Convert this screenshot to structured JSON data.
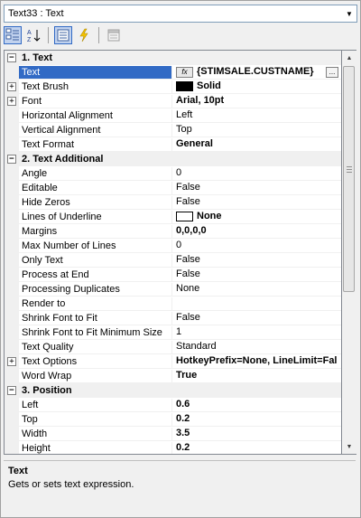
{
  "object_selector": {
    "value": "Text33 : Text"
  },
  "categories": [
    {
      "label": "1. Text",
      "rows": [
        {
          "name": "Text",
          "value": "{STIMSALE.CUSTNAME}",
          "bold": true,
          "selected": true,
          "expr": true,
          "expand": false
        },
        {
          "name": "Text Brush",
          "value": "Solid",
          "bold": true,
          "swatch": "#000000",
          "expand": true
        },
        {
          "name": "Font",
          "value": "Arial, 10pt",
          "bold": true,
          "expand": true
        },
        {
          "name": "Horizontal Alignment",
          "value": "Left"
        },
        {
          "name": "Vertical Alignment",
          "value": "Top"
        },
        {
          "name": "Text Format",
          "value": "General",
          "bold": true
        }
      ]
    },
    {
      "label": "2. Text  Additional",
      "rows": [
        {
          "name": "Angle",
          "value": "0"
        },
        {
          "name": "Editable",
          "value": "False"
        },
        {
          "name": "Hide Zeros",
          "value": "False"
        },
        {
          "name": "Lines of Underline",
          "value": "None",
          "bold": true,
          "swatch": "#ffffff"
        },
        {
          "name": "Margins",
          "value": "0,0,0,0",
          "bold": true
        },
        {
          "name": "Max Number of Lines",
          "value": "0"
        },
        {
          "name": "Only Text",
          "value": "False"
        },
        {
          "name": "Process at End",
          "value": "False"
        },
        {
          "name": "Processing Duplicates",
          "value": "None"
        },
        {
          "name": "Render to",
          "value": ""
        },
        {
          "name": "Shrink Font to Fit",
          "value": "False"
        },
        {
          "name": "Shrink Font to Fit Minimum Size",
          "value": "1"
        },
        {
          "name": "Text Quality",
          "value": "Standard"
        },
        {
          "name": "Text Options",
          "value": "HotkeyPrefix=None, LineLimit=Fal",
          "bold": true,
          "expand": true
        },
        {
          "name": "Word Wrap",
          "value": "True",
          "bold": true
        }
      ]
    },
    {
      "label": "3. Position",
      "rows": [
        {
          "name": "Left",
          "value": "0.6",
          "bold": true
        },
        {
          "name": "Top",
          "value": "0.2",
          "bold": true
        },
        {
          "name": "Width",
          "value": "3.5",
          "bold": true
        },
        {
          "name": "Height",
          "value": "0.2",
          "bold": true
        }
      ]
    }
  ],
  "description": {
    "title": "Text",
    "text": "Gets or sets text expression."
  },
  "colors": {
    "selection": "#316ac5",
    "category_bg": "#f0f0f0"
  }
}
